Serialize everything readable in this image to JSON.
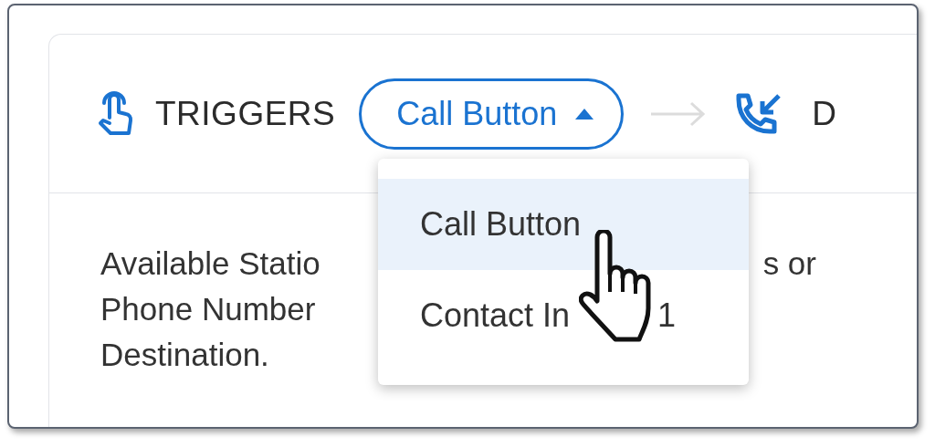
{
  "header": {
    "label": "TRIGGERS",
    "dropdown": {
      "value": "Call Button",
      "expanded": true
    },
    "next_step_label": "D"
  },
  "body_lines": [
    {
      "parts": [
        "Available Statio",
        "s or"
      ]
    },
    {
      "parts": [
        "Phone Number"
      ]
    },
    {
      "parts": [
        "Destination."
      ]
    }
  ],
  "menu": [
    {
      "parts": [
        "Call Button"
      ],
      "selected": true
    },
    {
      "parts": [
        "Contact In",
        "1"
      ],
      "selected": false
    }
  ]
}
